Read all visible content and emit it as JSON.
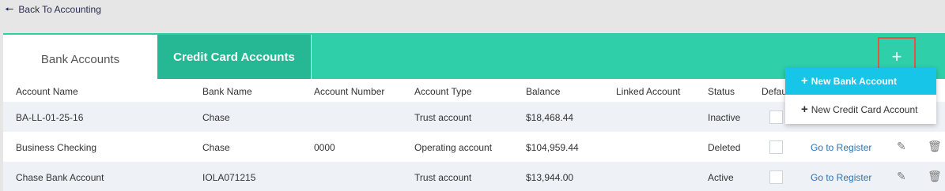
{
  "nav": {
    "back_label": "Back To Accounting"
  },
  "tabs": [
    {
      "label": "Bank Accounts",
      "active": true
    },
    {
      "label": "Credit Card Accounts",
      "active": false
    }
  ],
  "add_button": {
    "label": "+"
  },
  "columns": [
    "Account Name",
    "Bank Name",
    "Account Number",
    "Account Type",
    "Balance",
    "Linked Account",
    "Status",
    "Defau"
  ],
  "rows": [
    {
      "account_name": "BA-LL-01-25-16",
      "bank_name": "Chase",
      "account_number": "",
      "account_type": "Trust account",
      "balance": "$18,468.44",
      "linked_account": "",
      "status": "Inactive",
      "register_label": "",
      "edit_icon": "",
      "delete_icon": ""
    },
    {
      "account_name": "Business Checking",
      "bank_name": "Chase",
      "account_number": "0000",
      "account_type": "Operating account",
      "balance": "$104,959.44",
      "linked_account": "",
      "status": "Deleted",
      "register_label": "Go to Register",
      "edit_icon": "✎",
      "delete_icon": "🗑"
    },
    {
      "account_name": "Chase Bank Account",
      "bank_name": "IOLA071215",
      "account_number": "",
      "account_type": "Trust account",
      "balance": "$13,944.00",
      "linked_account": "",
      "status": "Active",
      "register_label": "Go to Register",
      "edit_icon": "✎",
      "delete_icon": "🗑"
    }
  ],
  "dropdown": {
    "items": [
      {
        "label": "New Bank Account",
        "highlighted": true
      },
      {
        "label": "New Credit Card Account",
        "highlighted": false
      }
    ]
  },
  "colors": {
    "accent": "#2ecfa9",
    "tab_inactive": "#26b895",
    "dropdown_highlight": "#16c5e8",
    "link": "#2a74b8",
    "focus_box": "#e05545"
  }
}
